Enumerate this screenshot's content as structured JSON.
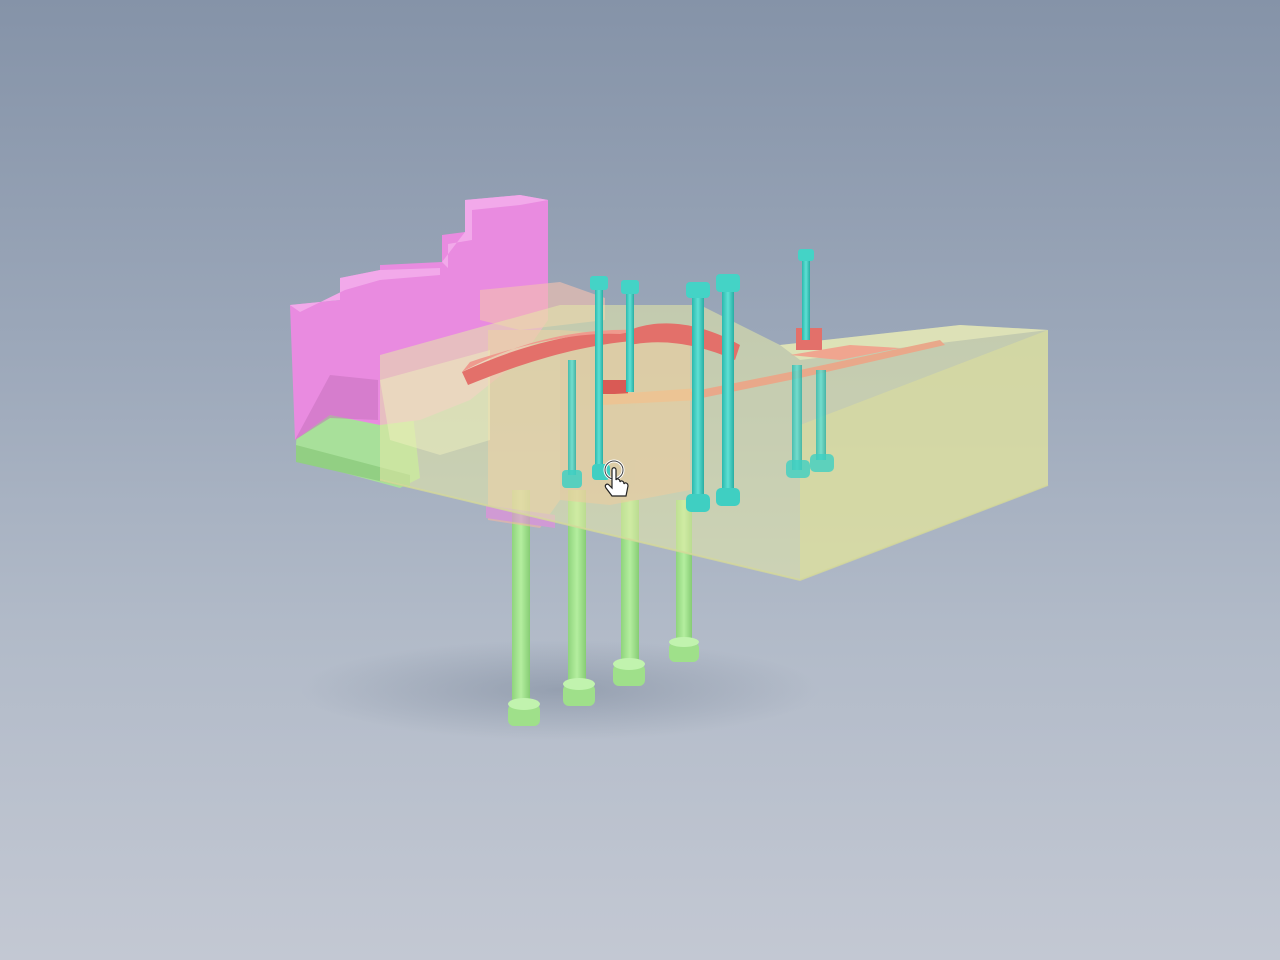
{
  "viewer": {
    "background": {
      "top": "#8593a8",
      "bottom": "#c3c8d3"
    },
    "parts": {
      "die_base": {
        "color": "#e6eaa8",
        "opacity": 0.55
      },
      "left_blocks": {
        "color": "#e98be0"
      },
      "left_base": {
        "color": "#a8e09a"
      },
      "support_pillars": {
        "color": "#a3e38f"
      },
      "guide_pins": {
        "color": "#3fcfc2"
      },
      "insert_plates": {
        "color": "#e3706a"
      },
      "cavity_blocks": {
        "color": "#f2b6a6",
        "opacity": 0.6
      }
    },
    "cursor": {
      "icon": "hand-rotate-icon"
    }
  }
}
